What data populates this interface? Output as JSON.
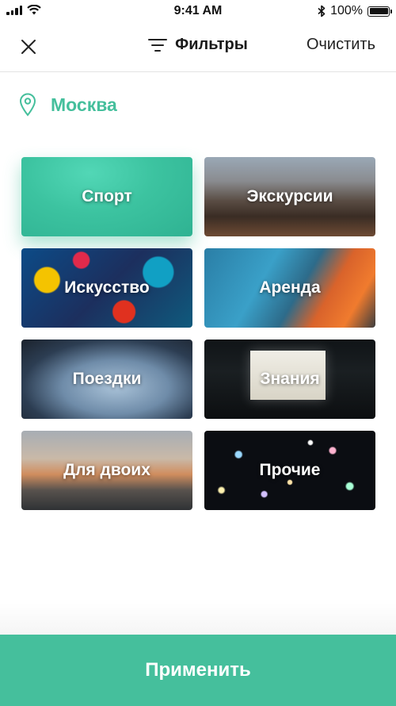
{
  "status_bar": {
    "time": "9:41 AM",
    "battery": "100%",
    "battery_level": 1.0
  },
  "nav": {
    "close_icon": "close-icon",
    "filter_icon": "filter-icon",
    "title": "Фильтры",
    "clear_label": "Очистить"
  },
  "location": {
    "icon": "location-pin-icon",
    "city": "Москва"
  },
  "categories": [
    {
      "label": "Спорт",
      "selected": true
    },
    {
      "label": "Экскурсии",
      "selected": false
    },
    {
      "label": "Искусство",
      "selected": false
    },
    {
      "label": "Аренда",
      "selected": false
    },
    {
      "label": "Поездки",
      "selected": false
    },
    {
      "label": "Знания",
      "selected": false
    },
    {
      "label": "Для двоих",
      "selected": false
    },
    {
      "label": "Прочие",
      "selected": false
    }
  ],
  "apply": {
    "label": "Применить"
  },
  "colors": {
    "accent": "#45bf9c",
    "divider": "#e3e3e3"
  }
}
